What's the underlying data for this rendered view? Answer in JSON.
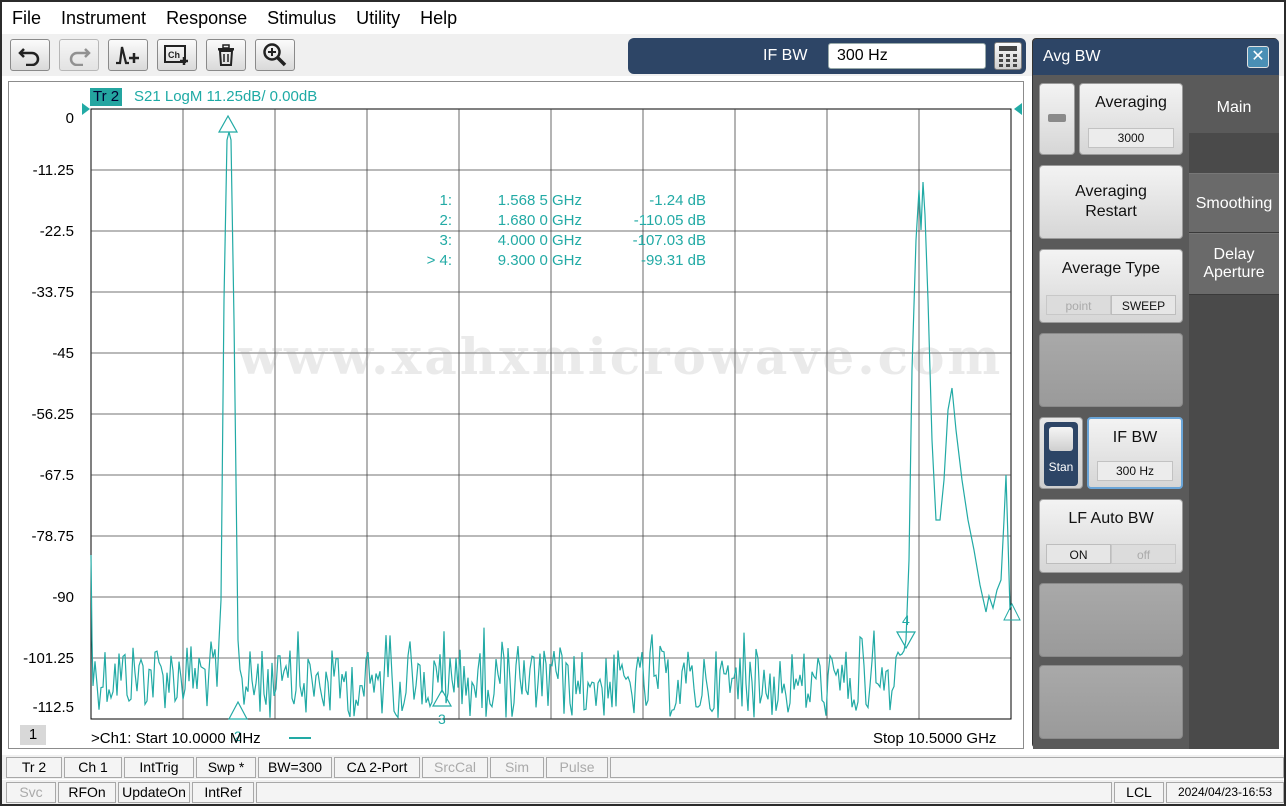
{
  "menu": [
    "File",
    "Instrument",
    "Response",
    "Stimulus",
    "Utility",
    "Help"
  ],
  "toolbar": {
    "icons": [
      "undo-icon",
      "redo-icon",
      "marker-add-icon",
      "channel-add-icon",
      "trash-icon",
      "zoom-icon"
    ]
  },
  "entry": {
    "label": "IF BW",
    "value": "300 Hz"
  },
  "trace": {
    "tag": "Tr 2",
    "info": "S21 LogM 11.25dB/  0.00dB",
    "color": "#22aaa5"
  },
  "y_axis": [
    "0",
    "-11.25",
    "-22.5",
    "-33.75",
    "-45",
    "-56.25",
    "-67.5",
    "-78.75",
    "-90",
    "-101.25",
    "-112.5"
  ],
  "markers": [
    {
      "num": "1:",
      "freq": "1.568 5 GHz",
      "value": "-1.24 dB"
    },
    {
      "num": "2:",
      "freq": "1.680 0 GHz",
      "value": "-110.05 dB"
    },
    {
      "num": "3:",
      "freq": "4.000 0 GHz",
      "value": "-107.03 dB"
    },
    {
      "num": "> 4:",
      "freq": "9.300 0 GHz",
      "value": "-99.31 dB"
    }
  ],
  "marker_labels": [
    "2",
    "3",
    "4"
  ],
  "channel": {
    "number": "1",
    "start": ">Ch1:  Start   10.0000 MHz",
    "stop": "Stop  10.5000 GHz"
  },
  "watermark": "www.xahxmicrowave.com",
  "side": {
    "title": "Avg BW",
    "close": "✕",
    "averaging": {
      "label": "Averaging",
      "value": "3000"
    },
    "restart": "Averaging Restart",
    "avg_type": {
      "label": "Average Type",
      "opt1": "point",
      "opt2": "SWEEP"
    },
    "ifbw": {
      "label": "IF BW",
      "value": "300 Hz",
      "toggle": "Stan"
    },
    "lf_auto": {
      "label": "LF Auto BW",
      "on": "ON",
      "off": "off"
    },
    "tabs": [
      "Main",
      "Smoothing",
      "Delay Aperture"
    ]
  },
  "status1": [
    "Tr 2",
    "Ch 1",
    "IntTrig",
    "Swp *",
    "BW=300",
    "CΔ 2-Port",
    "SrcCal",
    "Sim",
    "Pulse"
  ],
  "status2": [
    "Svc",
    "RFOn",
    "UpdateOn",
    "IntRef"
  ],
  "status2_right": {
    "mode": "LCL",
    "datetime": "2024/04/23-16:53"
  }
}
